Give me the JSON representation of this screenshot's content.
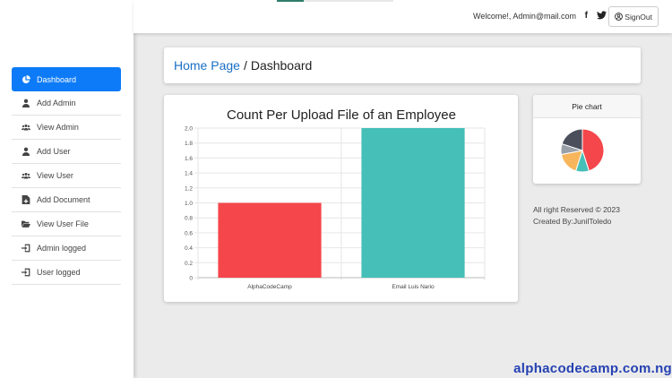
{
  "sidebar": {
    "items": [
      {
        "label": "Dashboard",
        "icon": "pie-chart-icon",
        "active": true
      },
      {
        "label": "Add Admin",
        "icon": "user-icon"
      },
      {
        "label": "View Admin",
        "icon": "users-icon"
      },
      {
        "label": "Add User",
        "icon": "user-icon"
      },
      {
        "label": "View User",
        "icon": "users-icon"
      },
      {
        "label": "Add Document",
        "icon": "file-plus-icon"
      },
      {
        "label": "View User File",
        "icon": "folder-open-icon"
      },
      {
        "label": "Admin logged",
        "icon": "sign-in-icon"
      },
      {
        "label": "User logged",
        "icon": "sign-in-icon"
      }
    ]
  },
  "header": {
    "welcome": "Welcome!, Admin@mail.com",
    "facebook": "f",
    "signout": "SignOut"
  },
  "breadcrumb": {
    "home": "Home Page",
    "sep": "/",
    "current": "Dashboard"
  },
  "chart_data": [
    {
      "type": "bar",
      "title": "Count Per Upload File of an Employee",
      "categories": [
        "AlphaCodeCamp",
        "Email Luis Nario"
      ],
      "values": [
        1,
        2
      ],
      "colors": [
        "#f5464b",
        "#45bfb8"
      ],
      "ylim": [
        0,
        2
      ],
      "yticks": [
        "0",
        "0.2",
        "0.4",
        "0.6",
        "0.8",
        "1.0",
        "1.2",
        "1.4",
        "1.6",
        "1.8",
        "2.0"
      ],
      "grid": true
    },
    {
      "type": "pie",
      "title": "Pie chart",
      "values": [
        45,
        10,
        17,
        8,
        20
      ],
      "colors": [
        "#f5464b",
        "#45bfb8",
        "#f7b55c",
        "#9aa0a8",
        "#4b4f5c"
      ]
    }
  ],
  "footer": {
    "line1": "All right Reserved © 2023",
    "line2": "Created By:JunilToledo"
  },
  "watermark": "alphacodecamp.com.ng"
}
